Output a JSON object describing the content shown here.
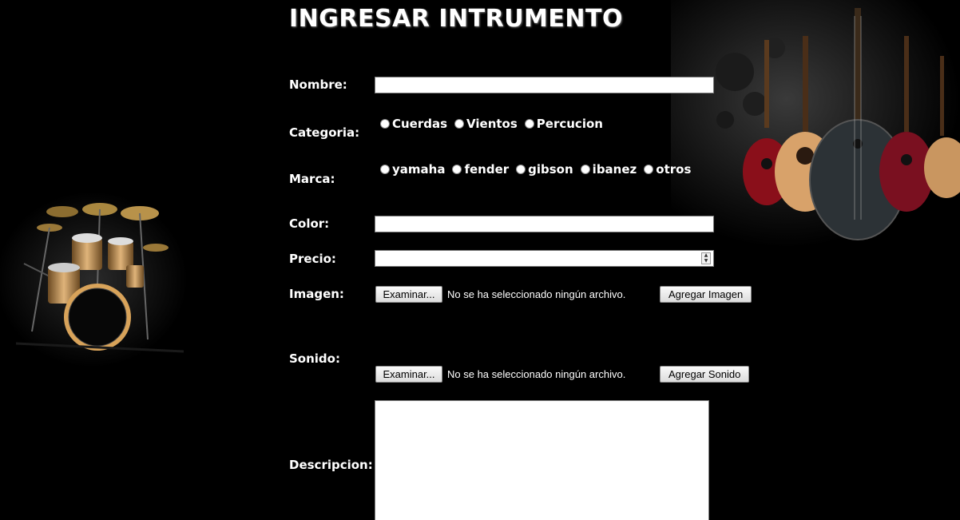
{
  "page": {
    "title": "INGRESAR INTRUMENTO"
  },
  "form": {
    "nombre_label": "Nombre:",
    "categoria_label": "Categoria:",
    "categoria_options": [
      "Cuerdas",
      "Vientos",
      "Percucion"
    ],
    "marca_label": "Marca:",
    "marca_options": [
      "yamaha",
      "fender",
      "gibson",
      "ibanez",
      "otros"
    ],
    "color_label": "Color:",
    "precio_label": "Precio:",
    "imagen_label": "Imagen:",
    "sonido_label": "Sonido:",
    "descripcion_label": "Descripcion:",
    "nombre_value": "",
    "color_value": "",
    "precio_value": "",
    "descripcion_value": ""
  },
  "imagen": {
    "browse_label": "Examinar...",
    "status": "No se ha seleccionado ningún archivo.",
    "add_label": "Agregar Imagen"
  },
  "sonido": {
    "browse_label": "Examinar...",
    "status": "No se ha seleccionado ningún archivo.",
    "add_label": "Agregar Sonido"
  },
  "icons": {
    "drum_set": "drum-set-icon",
    "guitars": "guitars-icon"
  }
}
